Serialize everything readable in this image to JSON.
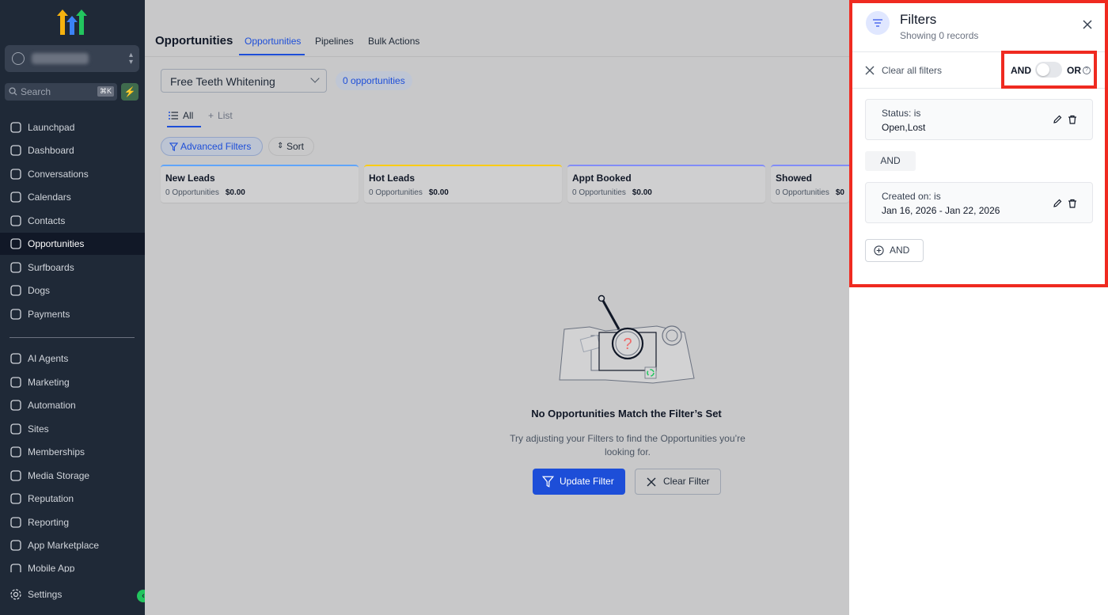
{
  "sidebar": {
    "search_placeholder": "Search",
    "search_shortcut": "⌘K",
    "items": [
      {
        "label": "Launchpad",
        "icon": "launchpad-icon"
      },
      {
        "label": "Dashboard",
        "icon": "dashboard-icon"
      },
      {
        "label": "Conversations",
        "icon": "chat-icon"
      },
      {
        "label": "Calendars",
        "icon": "calendar-icon"
      },
      {
        "label": "Contacts",
        "icon": "contacts-icon"
      },
      {
        "label": "Opportunities",
        "icon": "opportunities-icon",
        "active": true
      },
      {
        "label": "Surfboards",
        "icon": "surfboard-icon"
      },
      {
        "label": "Dogs",
        "icon": "dog-icon"
      },
      {
        "label": "Payments",
        "icon": "payments-icon"
      },
      {
        "label": "AI Agents",
        "icon": "sparkle-icon"
      },
      {
        "label": "Marketing",
        "icon": "send-icon"
      },
      {
        "label": "Automation",
        "icon": "automation-icon"
      },
      {
        "label": "Sites",
        "icon": "sites-icon"
      },
      {
        "label": "Memberships",
        "icon": "membership-icon"
      },
      {
        "label": "Media Storage",
        "icon": "image-icon"
      },
      {
        "label": "Reputation",
        "icon": "star-icon"
      },
      {
        "label": "Reporting",
        "icon": "chart-line-icon"
      },
      {
        "label": "App Marketplace",
        "icon": "grid-icon"
      },
      {
        "label": "Mobile App",
        "icon": "mobile-icon"
      }
    ],
    "settings_label": "Settings",
    "colors": {
      "bg": "#1f2937",
      "active_bg": "#111827"
    }
  },
  "header": {
    "title": "Opportunities",
    "tabs": [
      {
        "label": "Opportunities",
        "active": true
      },
      {
        "label": "Pipelines"
      },
      {
        "label": "Bulk Actions"
      }
    ]
  },
  "toolbar": {
    "pipeline_value": "Free Teeth Whitening",
    "count_badge": "0 opportunities",
    "view_all": "All",
    "view_list": "List",
    "advanced_filters": "Advanced Filters",
    "sort": "Sort"
  },
  "stages": [
    {
      "name": "New Leads",
      "count": "0 Opportunities",
      "amount": "$0.00",
      "color": "#60a5fa"
    },
    {
      "name": "Hot Leads",
      "count": "0 Opportunities",
      "amount": "$0.00",
      "color": "#facc15"
    },
    {
      "name": "Appt Booked",
      "count": "0 Opportunities",
      "amount": "$0.00",
      "color": "#818cf8"
    },
    {
      "name": "Showed",
      "count": "0 Opportunities",
      "amount": "$0",
      "color": "#818cf8"
    }
  ],
  "empty_state": {
    "title": "No Opportunities Match the Filter’s Set",
    "text": "Try adjusting your Filters to find the Opportunities you’re looking for.",
    "update_button": "Update Filter",
    "clear_button": "Clear Filter"
  },
  "filter_panel": {
    "title": "Filters",
    "subtitle": "Showing 0 records",
    "clear_all": "Clear all filters",
    "and_label": "AND",
    "or_label": "OR",
    "logic_is_or": false,
    "filters": [
      {
        "label": "Status: is",
        "value": "Open,Lost"
      },
      {
        "label": "Created on: is",
        "value": "Jan 16, 2026 - Jan 22, 2026"
      }
    ],
    "separator": "AND",
    "add_button": "AND",
    "highlight_color": "#ef2a20"
  }
}
